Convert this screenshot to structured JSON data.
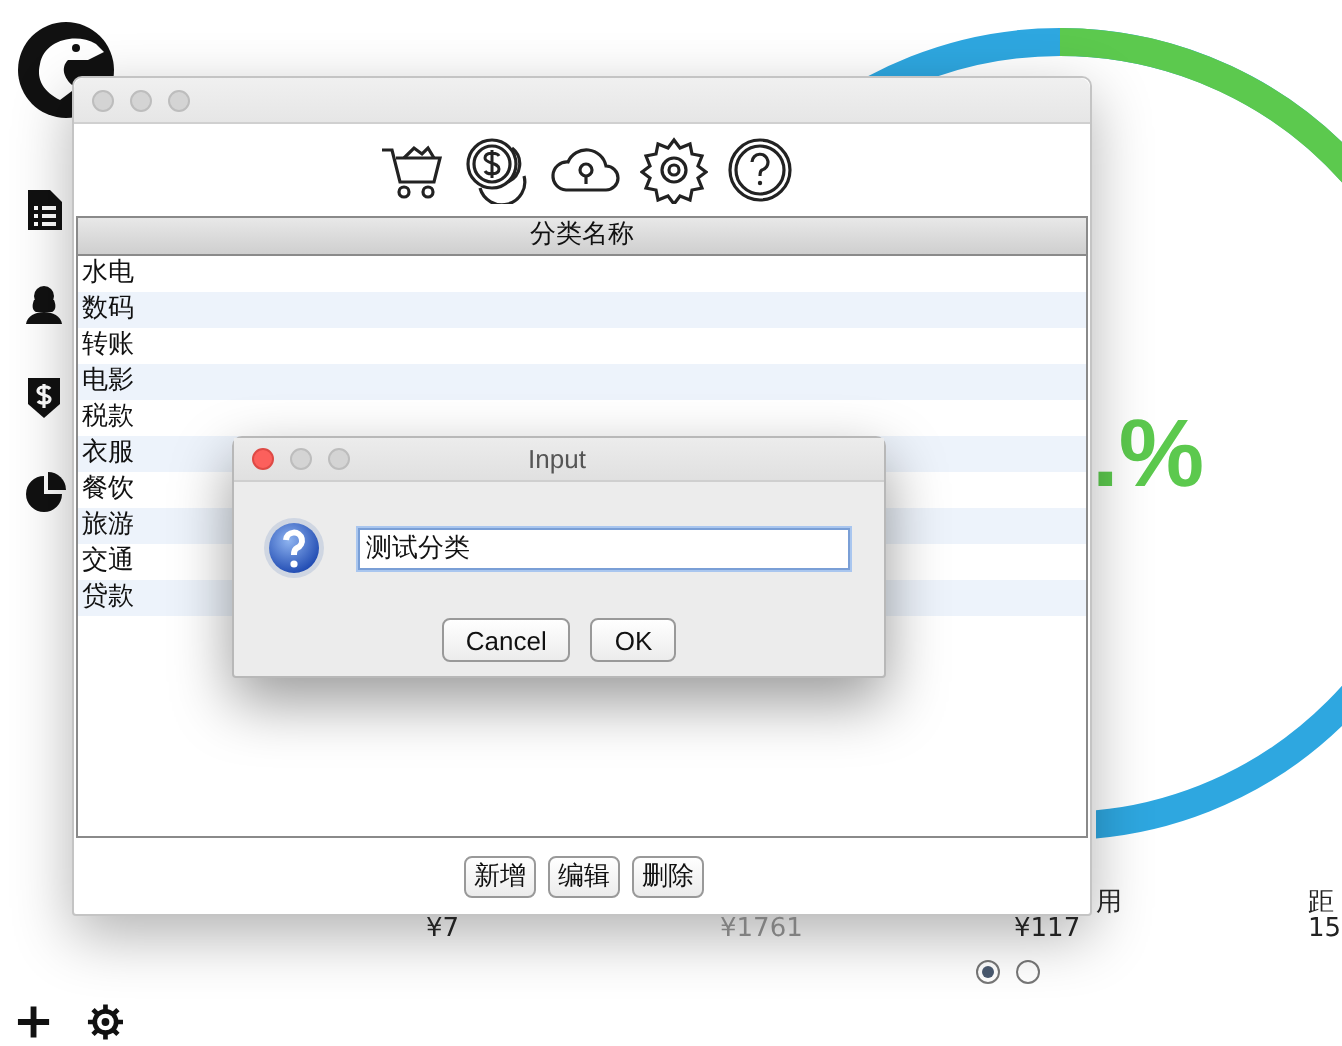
{
  "background_app": {
    "percent_text": ".%",
    "stats": [
      {
        "value": "¥7",
        "muted": false
      },
      {
        "value": "¥1761",
        "muted": true
      },
      {
        "label": "用",
        "value": "¥117",
        "muted": false
      },
      {
        "label": "距",
        "value": "15",
        "muted": false
      }
    ],
    "pager": [
      {
        "selected": true
      },
      {
        "selected": false
      }
    ]
  },
  "main_window": {
    "active": false,
    "table": {
      "columns": [
        "分类名称"
      ],
      "rows": [
        "水电",
        "数码",
        "转账",
        "电影",
        "税款",
        "衣服",
        "餐饮",
        "旅游",
        "交通",
        "贷款"
      ]
    },
    "buttons": [
      "新增",
      "编辑",
      "删除"
    ]
  },
  "dialog": {
    "title": "Input",
    "active": true,
    "field": {
      "value": "测试分类"
    },
    "buttons": [
      {
        "label": "Cancel"
      },
      {
        "label": "OK"
      }
    ]
  }
}
